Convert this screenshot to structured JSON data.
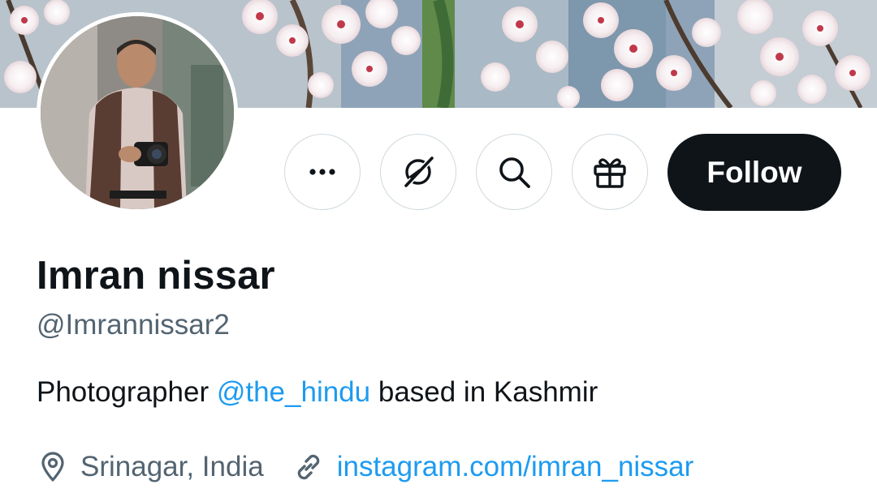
{
  "profile": {
    "display_name": "Imran nissar",
    "handle": "@Imrannissar2",
    "bio": {
      "before": "Photographer ",
      "mention": "@the_hindu",
      "after": " based in Kashmir"
    },
    "location": "Srinagar, India",
    "website": "instagram.com/imran_nissar"
  },
  "actions": {
    "more_icon": "more-horizontal-icon",
    "grok_icon": "grok-icon",
    "search_icon": "search-icon",
    "gift_icon": "gift-icon",
    "follow_label": "Follow"
  },
  "colors": {
    "link": "#1d9bf0",
    "secondary_text": "#536471",
    "primary_text": "#0f1419",
    "follow_bg": "#0f1419",
    "button_border": "#cfd9de"
  }
}
